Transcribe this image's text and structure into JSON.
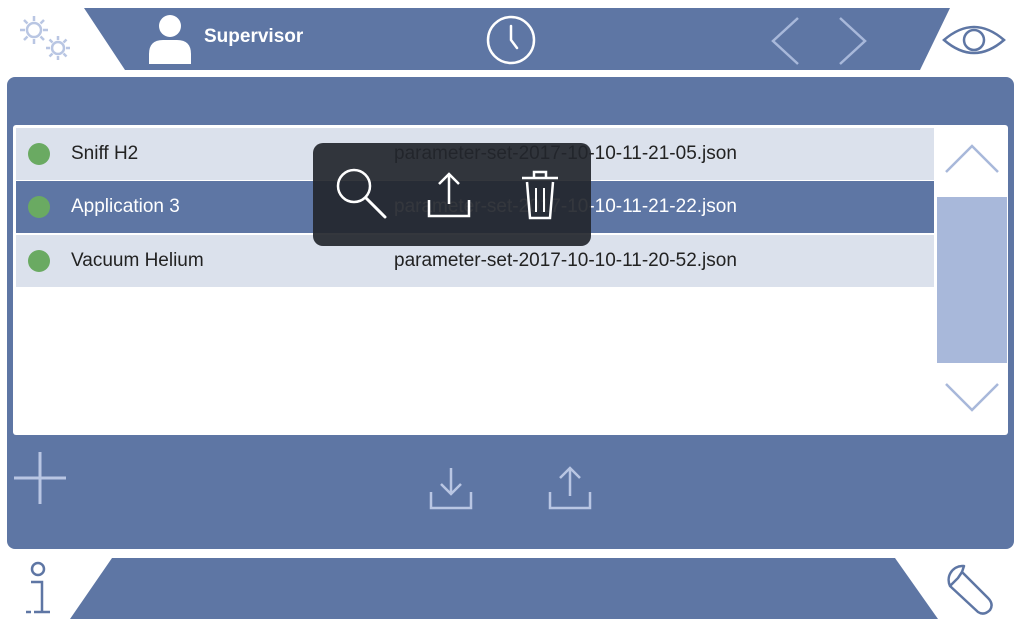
{
  "header": {
    "user_label": "Supervisor"
  },
  "parameter_sets": [
    {
      "name": "Sniff H2",
      "file": "parameter-set-2017-10-10-11-21-05.json",
      "status": "active",
      "selected": false
    },
    {
      "name": "Application 3",
      "file": "parameter-set-2017-10-10-11-21-22.json",
      "status": "active",
      "selected": true
    },
    {
      "name": "Vacuum Helium",
      "file": "parameter-set-2017-10-10-11-20-52.json",
      "status": "active",
      "selected": false
    }
  ],
  "colors": {
    "primary": "#5e76a4",
    "row_light": "#dbe1ec",
    "scrollbar": "#a8b8da",
    "status_dot": "#6aaa62",
    "icon": "#b9c6e3"
  },
  "icons": {
    "settings": "gears-icon",
    "user": "user-icon",
    "clock": "clock-icon",
    "back": "chevron-left-icon",
    "forward": "chevron-right-icon",
    "view": "eye-icon",
    "search": "magnifier-icon",
    "export": "upload-icon",
    "delete": "trash-icon",
    "add": "plus-icon",
    "import": "download-icon",
    "info": "info-icon",
    "service": "wrench-icon"
  }
}
